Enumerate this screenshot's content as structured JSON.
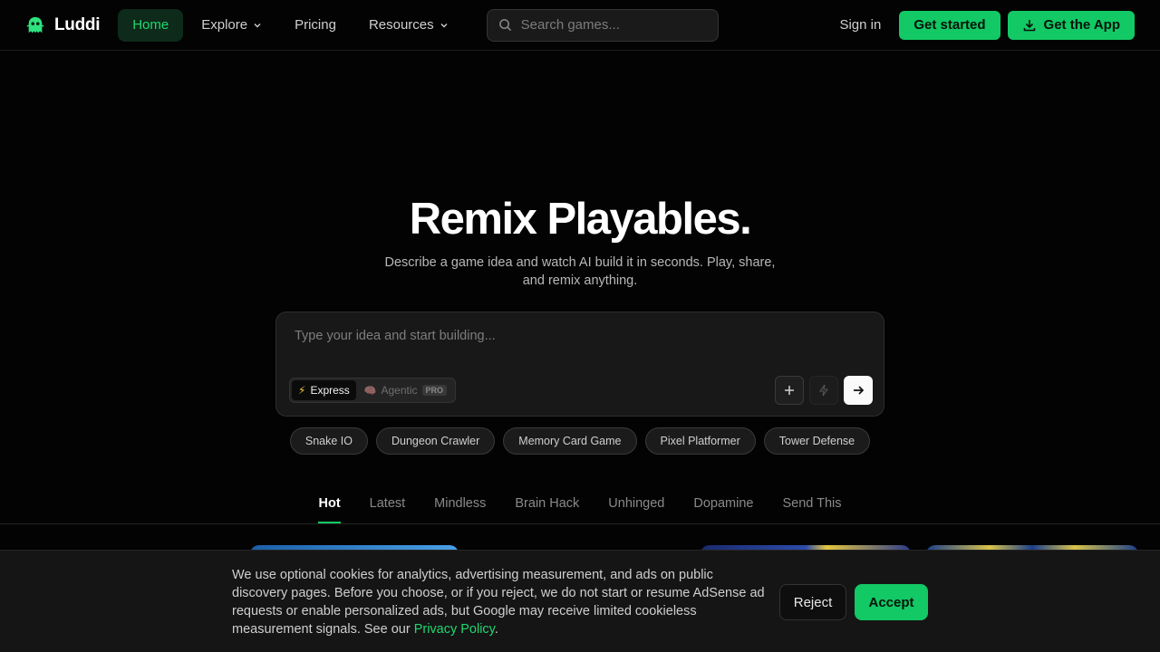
{
  "brand": {
    "name": "Luddi",
    "icon": "ghost-logo-icon"
  },
  "nav": {
    "items": [
      {
        "label": "Home",
        "active": true,
        "has_dropdown": false
      },
      {
        "label": "Explore",
        "active": false,
        "has_dropdown": true
      },
      {
        "label": "Pricing",
        "active": false,
        "has_dropdown": false
      },
      {
        "label": "Resources",
        "active": false,
        "has_dropdown": true
      }
    ],
    "search_placeholder": "Search games...",
    "signin_label": "Sign in",
    "get_started_label": "Get started",
    "get_app_label": "Get the App"
  },
  "hero": {
    "title": "Remix Playables.",
    "subtitle": "Describe a game idea and watch AI build it in seconds. Play, share, and remix anything."
  },
  "prompt": {
    "placeholder": "Type your idea and start building...",
    "modes": [
      {
        "label": "Express",
        "icon": "lightning-icon",
        "selected": true
      },
      {
        "label": "Agentic",
        "icon": "brain-icon",
        "selected": false,
        "badge": "PRO"
      }
    ]
  },
  "suggestions": [
    "Snake IO",
    "Dungeon Crawler",
    "Memory Card Game",
    "Pixel Platformer",
    "Tower Defense"
  ],
  "tabs": [
    {
      "label": "Hot",
      "active": true
    },
    {
      "label": "Latest",
      "active": false
    },
    {
      "label": "Mindless",
      "active": false
    },
    {
      "label": "Brain Hack",
      "active": false
    },
    {
      "label": "Unhinged",
      "active": false
    },
    {
      "label": "Dopamine",
      "active": false
    },
    {
      "label": "Send This",
      "active": false
    }
  ],
  "cookie": {
    "text": "We use optional cookies for analytics, advertising measurement, and ads on public discovery pages. Before you choose, or if you reject, we do not start or resume AdSense ad requests or enable personalized ads, but Google may receive limited cookieless measurement signals. See our ",
    "link_label": "Privacy Policy",
    "trailing": ".",
    "reject_label": "Reject",
    "accept_label": "Accept"
  },
  "colors": {
    "accent": "#12c965",
    "background": "#030303"
  }
}
